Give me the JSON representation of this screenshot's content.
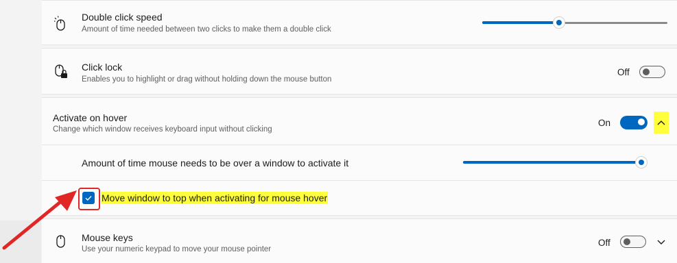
{
  "double_click": {
    "title": "Double click speed",
    "description": "Amount of time needed between two clicks to make them a double click",
    "icon": "mouse-click-icon",
    "slider_value": 0.41
  },
  "click_lock": {
    "title": "Click lock",
    "description": "Enables you to highlight or drag without holding down the mouse button",
    "icon": "mouse-lock-icon",
    "state_label": "Off",
    "enabled": false
  },
  "activate_on_hover": {
    "title": "Activate on hover",
    "description": "Change which window receives keyboard input without clicking",
    "state_label": "On",
    "enabled": true,
    "expanded": true,
    "hover_time": {
      "label": "Amount of time mouse needs to be over a window to activate it",
      "slider_value": 1.0
    },
    "move_to_top": {
      "label": "Move window to top when activating for mouse hover",
      "checked": true
    }
  },
  "mouse_keys": {
    "title": "Mouse keys",
    "description": "Use your numeric keypad to move your mouse pointer",
    "icon": "mouse-icon",
    "state_label": "Off",
    "enabled": false
  },
  "colors": {
    "accent": "#0067c0",
    "highlight": "#ffff3b",
    "annotation": "#e12626"
  }
}
